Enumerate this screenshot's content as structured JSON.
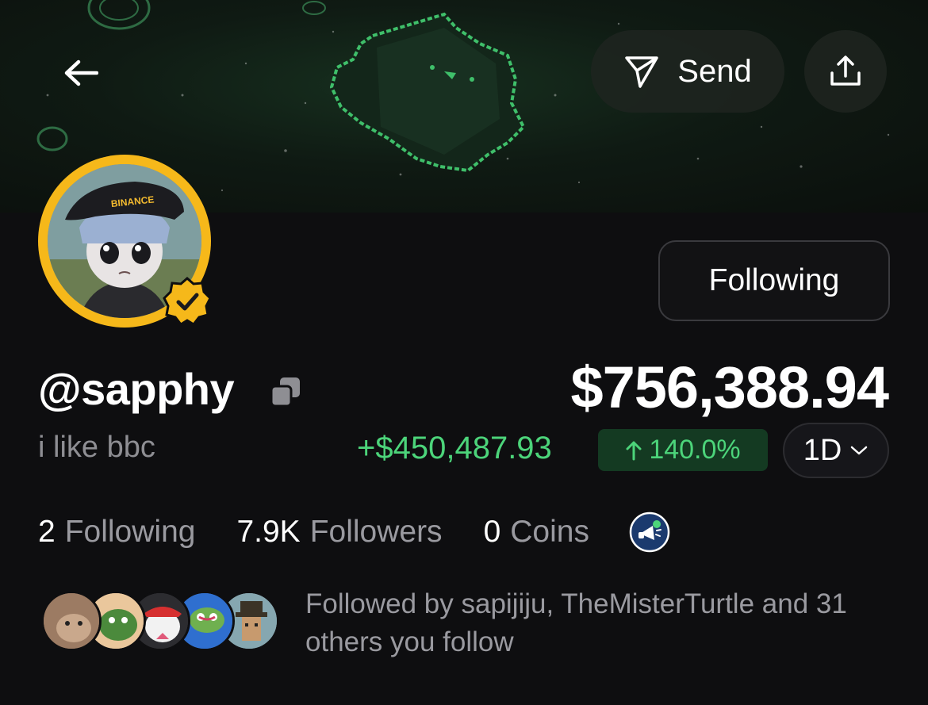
{
  "nav": {
    "send_label": "Send"
  },
  "profile": {
    "username": "@sapphy",
    "bio": "i like bbc",
    "follow_button_label": "Following",
    "avatar_cap_text": "BINANCE"
  },
  "portfolio": {
    "balance": "$756,388.94",
    "change_amount": "+$450,487.93",
    "change_percent": "140.0%",
    "period": "1D",
    "up_color": "#4cd47a"
  },
  "stats": {
    "following_count": "2",
    "following_label": "Following",
    "followers_count": "7.9K",
    "followers_label": "Followers",
    "coins_count": "0",
    "coins_label": "Coins"
  },
  "social": {
    "followed_by_text": "Followed by sapijiju, TheMisterTurtle and 31 others you follow"
  },
  "colors": {
    "background": "#0e0e10",
    "avatar_ring": "#f6b81a",
    "muted_text": "#9a9aa0"
  },
  "icons": [
    "back-arrow-icon",
    "send-icon",
    "share-icon",
    "verified-icon",
    "copy-icon",
    "chevron-down-icon",
    "megaphone-badge-icon"
  ]
}
